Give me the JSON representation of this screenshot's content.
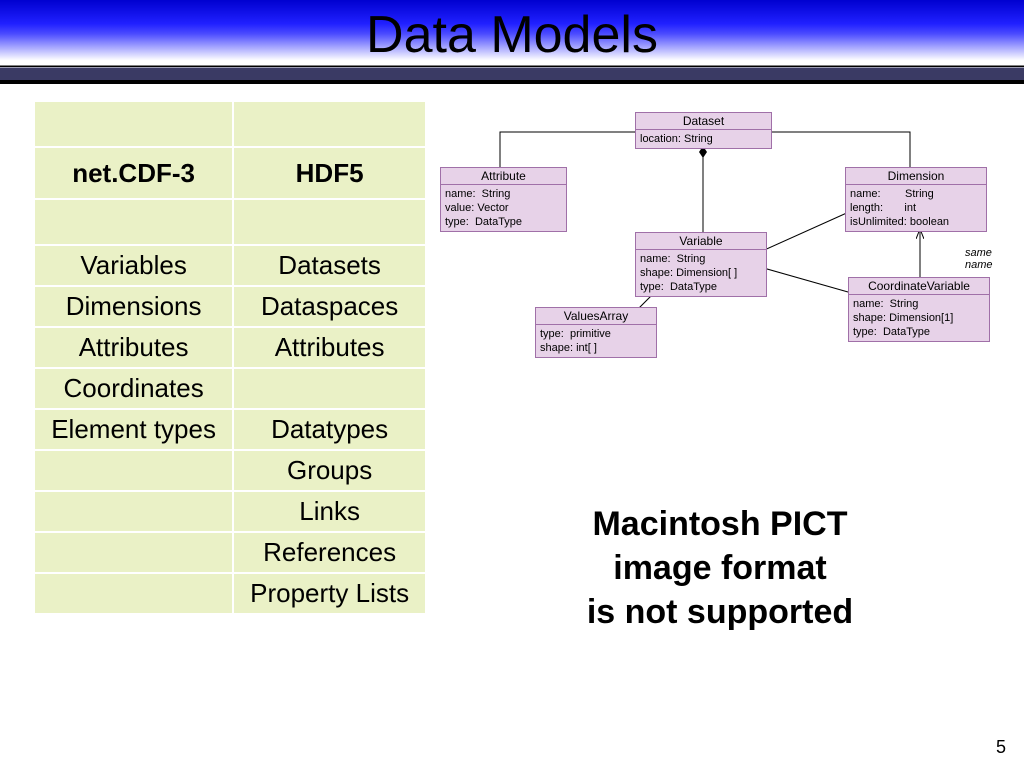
{
  "title": "Data Models",
  "table": {
    "headers": {
      "c1": "net.CDF-3",
      "c2": "HDF5"
    },
    "rows": [
      {
        "c1": "Variables",
        "c2": "Datasets"
      },
      {
        "c1": "Dimensions",
        "c2": "Dataspaces"
      },
      {
        "c1": "Attributes",
        "c2": "Attributes"
      },
      {
        "c1": "Coordinates",
        "c2": ""
      },
      {
        "c1": "Element types",
        "c2": "Datatypes"
      },
      {
        "c1": "",
        "c2": "Groups"
      },
      {
        "c1": "",
        "c2": "Links"
      },
      {
        "c1": "",
        "c2": "References"
      },
      {
        "c1": "",
        "c2": "Property Lists"
      }
    ]
  },
  "diagram": {
    "dataset": {
      "title": "Dataset",
      "body": "location: String"
    },
    "attribute": {
      "title": "Attribute",
      "body": "name:  String\nvalue: Vector\ntype:  DataType"
    },
    "dimension": {
      "title": "Dimension",
      "body": "name:        String\nlength:       int\nisUnlimited: boolean"
    },
    "variable": {
      "title": "Variable",
      "body": "name:  String\nshape: Dimension[ ]\ntype:  DataType"
    },
    "values": {
      "title": "ValuesArray",
      "body": "type:  primitive\nshape: int[ ]"
    },
    "coordvar": {
      "title": "CoordinateVariable",
      "body": "name:  String\nshape: Dimension[1]\ntype:  DataType"
    },
    "note": "same\nname"
  },
  "pict_message": {
    "l1": "Macintosh PICT",
    "l2": "image format",
    "l3": "is not supported"
  },
  "page_number": "5"
}
